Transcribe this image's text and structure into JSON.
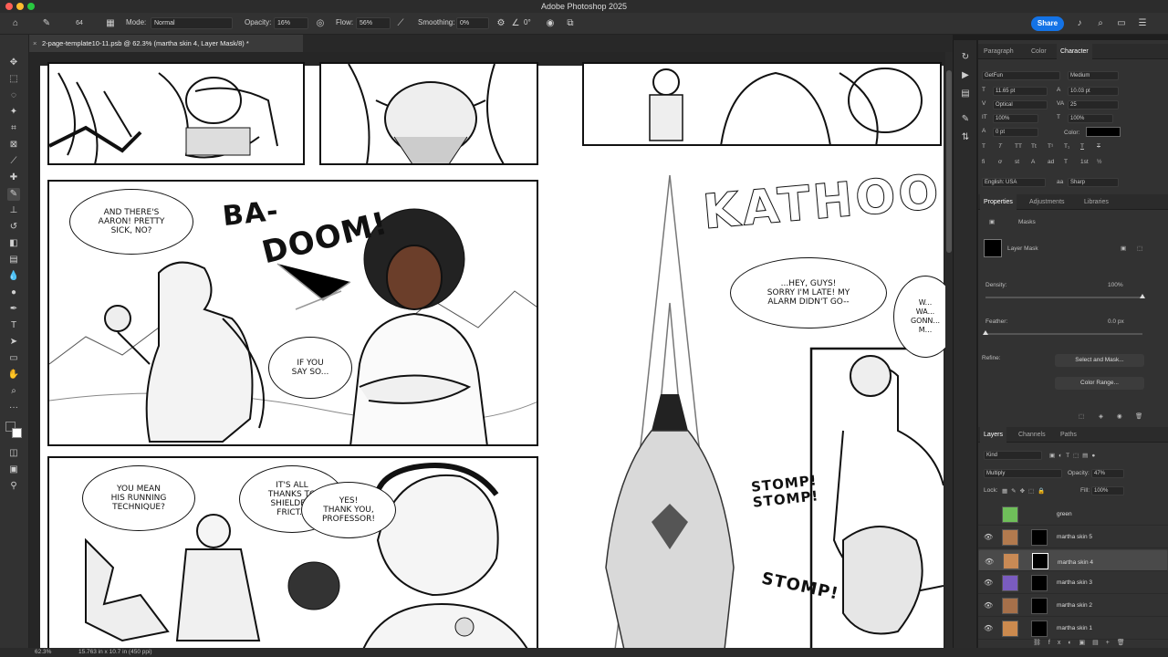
{
  "app": {
    "title": "Adobe Photoshop 2025"
  },
  "options": {
    "mode_label": "Mode:",
    "mode_value": "Normal",
    "opacity_label": "Opacity:",
    "opacity_value": "16%",
    "flow_label": "Flow:",
    "flow_value": "56%",
    "smoothing_label": "Smoothing:",
    "smoothing_value": "0%",
    "angle_value": "0°",
    "brush_size": "64",
    "share_label": "Share"
  },
  "document": {
    "tab_title": "2-page-template10-11.psb @ 62.3% (martha skin 4, Layer Mask/8) *"
  },
  "status": {
    "zoom": "62.3%",
    "doc_info": "15.763 in x 10.7 in (450 ppi)"
  },
  "comic": {
    "bubble1": "AND THERE'S\nAARON! PRETTY\nSICK, NO?",
    "sfx1": "BA-",
    "sfx2": "DOOM!",
    "bubble2": "IF YOU\nSAY SO...",
    "bubble3": "YOU MEAN\nHIS RUNNING\nTECHNIQUE?",
    "bubble4": "IT'S ALL\nTHANKS TO\nSHIELDE...\nFRICT...",
    "bubble5": "YES!\nTHANK YOU,\nPROFESSOR!",
    "sfx3": "KATHOO",
    "bubble6": "...HEY, GUYS!\nSORRY I'M LATE! MY\nALARM DIDN'T GO--",
    "bubble7": "W...\nWA...\nGONN...\nM...",
    "sfx4": "STOMP!\nSTOMP!",
    "sfx5": "STOMP!"
  },
  "character_panel": {
    "tabs": [
      "Paragraph",
      "Color",
      "Character"
    ],
    "font_family": "GetFun",
    "font_style": "Medium",
    "font_size": "11.65 pt",
    "leading": "10.03 pt",
    "kerning": "Optical",
    "tracking": "25",
    "vscale": "100%",
    "hscale": "100%",
    "baseline": "0 pt",
    "color_label": "Color:",
    "language": "English: USA",
    "antialias": "Sharp",
    "type_buttons": [
      "T",
      "T",
      "TT",
      "Tt",
      "T¹",
      "T₁",
      "T",
      "T"
    ],
    "ot_buttons": [
      "fi",
      "ơ",
      "st",
      "A",
      "ad",
      "T",
      "1st",
      "½"
    ]
  },
  "properties_panel": {
    "tabs": [
      "Properties",
      "Adjustments",
      "Libraries"
    ],
    "section": "Masks",
    "layer_mask_label": "Layer Mask",
    "density_label": "Density:",
    "density_value": "100%",
    "density_level": 1.0,
    "feather_label": "Feather:",
    "feather_value": "0.0 px",
    "feather_level": 0.0,
    "refine_label": "Refine:",
    "select_mask_btn": "Select and Mask...",
    "color_range_btn": "Color Range..."
  },
  "layers_panel": {
    "tabs": [
      "Layers",
      "Channels",
      "Paths"
    ],
    "kind": "Kind",
    "blend_mode": "Multiply",
    "opacity_label": "Opacity:",
    "opacity_value": "47%",
    "lock_label": "Lock:",
    "fill_label": "Fill:",
    "fill_value": "100%",
    "layers": [
      {
        "name": "green",
        "color": "#6fbf5a",
        "visible": false,
        "selected": false
      },
      {
        "name": "martha skin 5",
        "color": "#b27a4e",
        "visible": true,
        "selected": false
      },
      {
        "name": "martha skin 4",
        "color": "#c98a55",
        "visible": true,
        "selected": true
      },
      {
        "name": "martha skin 3",
        "color": "#7a5cc0",
        "visible": true,
        "selected": false
      },
      {
        "name": "martha skin 2",
        "color": "#a6704a",
        "visible": true,
        "selected": false
      },
      {
        "name": "martha skin 1",
        "color": "#cc8a4e",
        "visible": true,
        "selected": false
      }
    ]
  },
  "colors": {
    "accent": "#1473e6",
    "fg_swatch": "#000000",
    "bg_swatch": "#ffffff"
  }
}
